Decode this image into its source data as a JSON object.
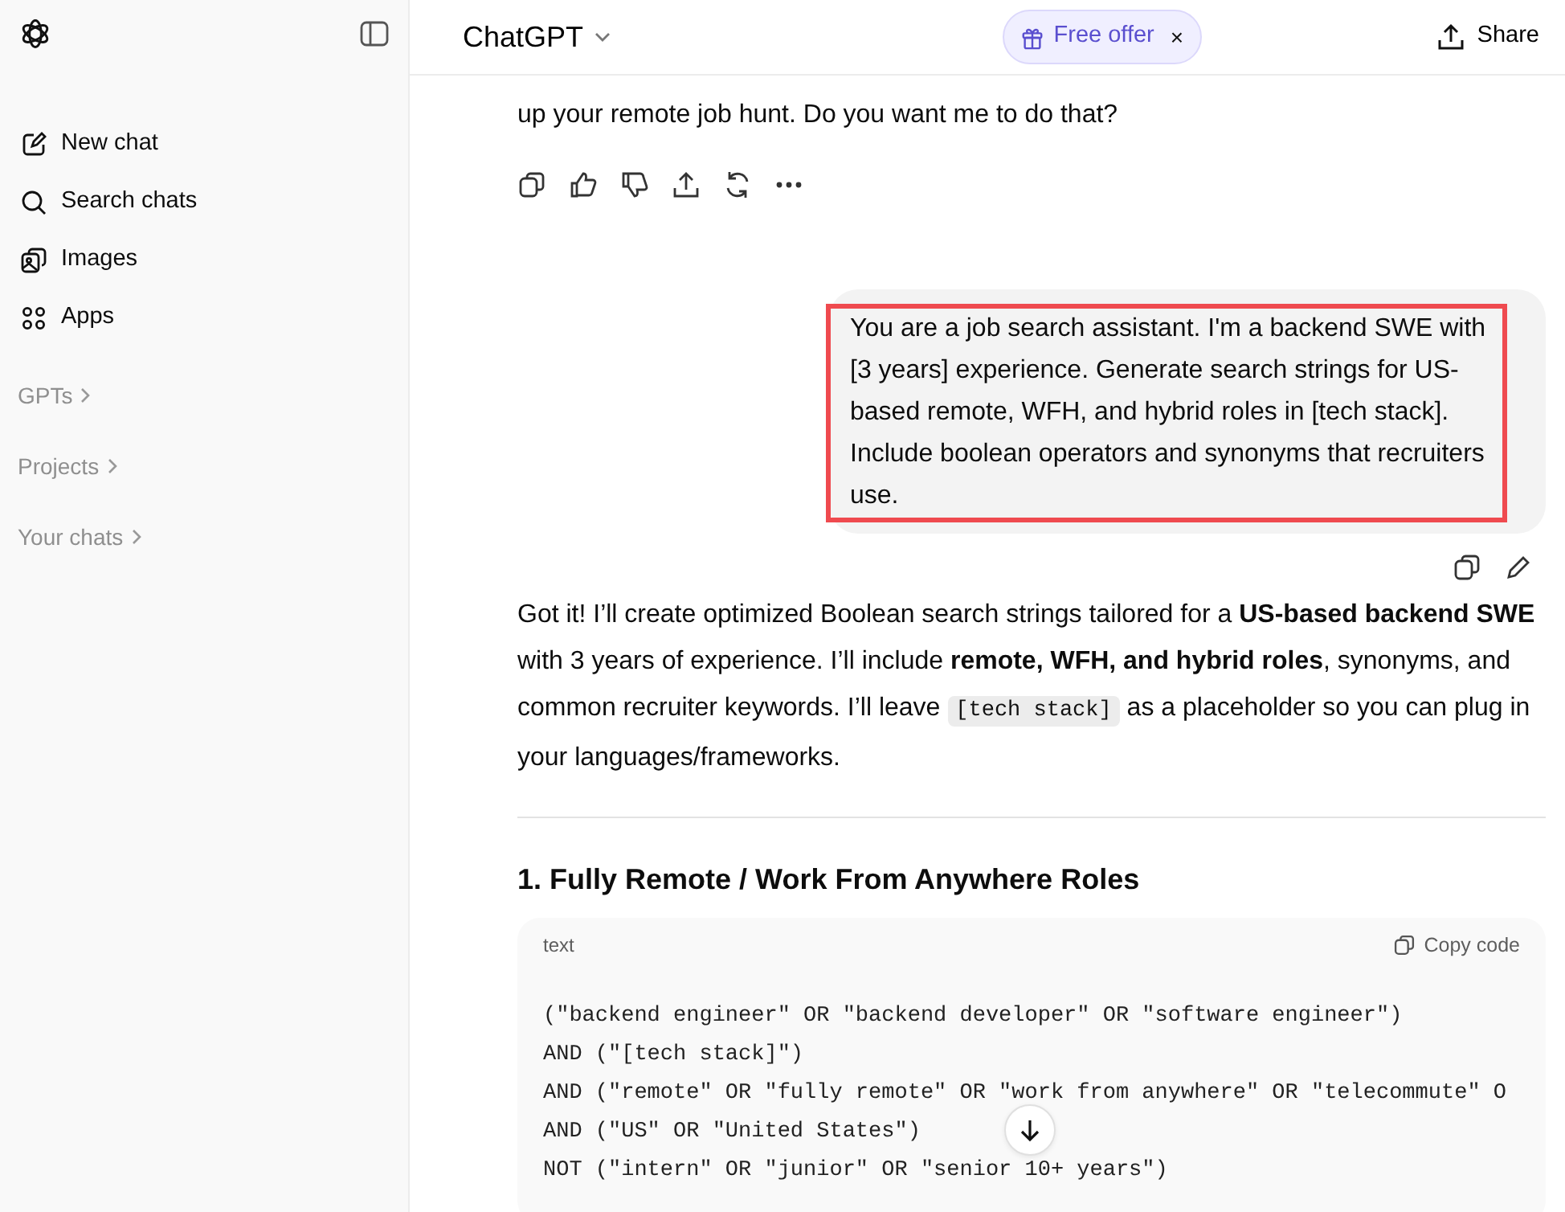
{
  "sidebar": {
    "items": [
      {
        "label": "New chat"
      },
      {
        "label": "Search chats"
      },
      {
        "label": "Images"
      },
      {
        "label": "Apps"
      }
    ],
    "sections": [
      {
        "label": "GPTs"
      },
      {
        "label": "Projects"
      },
      {
        "label": "Your chats"
      }
    ]
  },
  "header": {
    "title": "ChatGPT",
    "offer": "Free offer",
    "close": "×",
    "share": "Share"
  },
  "conversation": {
    "previous_reply_tail": "up your remote job hunt. Do you want me to do that?",
    "user_message": {
      "text": "You are a job search assistant. I'm a backend SWE with [3 years] experience. Generate search strings for US-based remote, WFH, and hybrid roles in [tech stack]. Include boolean operators and synonyms that recruiters use.",
      "highlighted": true
    },
    "reply": {
      "parts": [
        {
          "kind": "text",
          "text": "Got it! I’ll create optimized Boolean search strings tailored for a **US-based backend SWE** with 3 years of experience. I’ll include **remote, WFH, and hybrid roles**, synonyms, and common recruiter keywords. I’ll leave "
        },
        {
          "kind": "code",
          "text": "[tech stack]"
        },
        {
          "kind": "text",
          "text": " as a placeholder so you can plug in your languages/frameworks."
        }
      ],
      "heading": "1. Fully Remote / Work From Anywhere Roles",
      "code_block": {
        "language": "text",
        "copy_label": "Copy code",
        "lines": [
          "(\"backend engineer\" OR \"backend developer\" OR \"software engineer\")",
          "AND (\"[tech stack]\")",
          "AND (\"remote\" OR \"fully remote\" OR \"work from anywhere\" OR \"telecommute\" O",
          "AND (\"US\" OR \"United States\")",
          "NOT (\"intern\" OR \"junior\" OR \"senior 10+ years\")"
        ]
      }
    }
  }
}
